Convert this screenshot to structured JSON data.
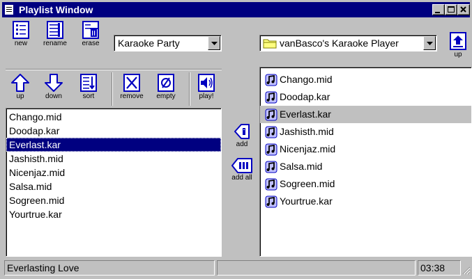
{
  "window": {
    "title": "Playlist Window"
  },
  "playlist_toolbar": {
    "new": "new",
    "rename": "rename",
    "erase": "erase",
    "up": "up",
    "down": "down",
    "sort": "sort",
    "remove": "remove",
    "empty": "empty",
    "play": "play!"
  },
  "playlist_combo": {
    "value": "Karaoke Party"
  },
  "folder_combo": {
    "value": "vanBasco's Karaoke Player"
  },
  "folder_toolbar": {
    "up": "up"
  },
  "middle": {
    "add": "add",
    "add_all": "add all"
  },
  "playlist": {
    "items": [
      "Chango.mid",
      "Doodap.kar",
      "Everlast.kar",
      "Jashisth.mid",
      "Nicenjaz.mid",
      "Salsa.mid",
      "Sogreen.mid",
      "Yourtrue.kar"
    ],
    "selected_index": 2
  },
  "files": {
    "items": [
      "Chango.mid",
      "Doodap.kar",
      "Everlast.kar",
      "Jashisth.mid",
      "Nicenjaz.mid",
      "Salsa.mid",
      "Sogreen.mid",
      "Yourtrue.kar"
    ],
    "highlighted_index": 2
  },
  "status": {
    "song": "Everlasting Love",
    "middle": "",
    "time": "03:38"
  },
  "colors": {
    "titlebar": "#000080",
    "face": "#c0c0c0",
    "selection": "#000080",
    "icon_blue": "#0000c0"
  }
}
